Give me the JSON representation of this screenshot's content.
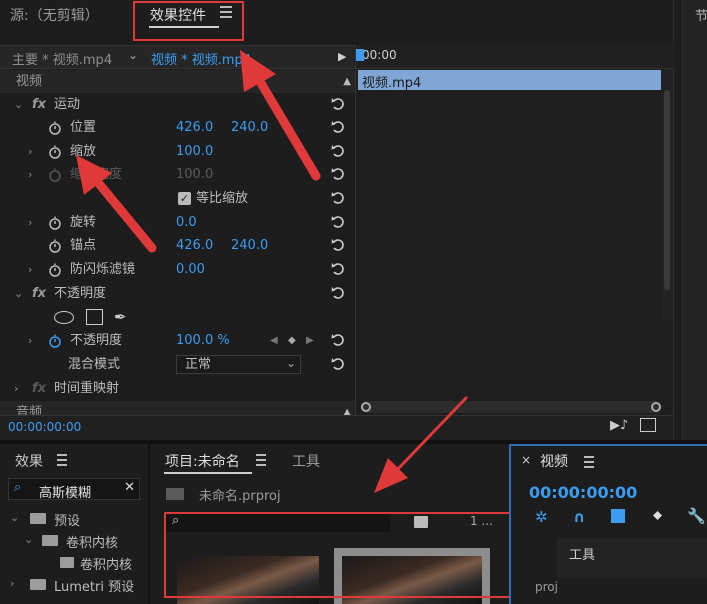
{
  "top": {
    "source_tab": "源:（无剪辑）",
    "effect_controls_tab": "效果控件",
    "right_edge": "节"
  },
  "ec": {
    "master_clip": "主要 * 视频.mp4",
    "seq_clip": "视频 * 视频.mp4",
    "timecode_ruler": "00:00",
    "clip_bar_label": "视频.mp4",
    "section_video": "视频",
    "motion": "运动",
    "position": "位置",
    "position_x": "426.0",
    "position_y": "240.0",
    "scale": "缩放",
    "scale_val": "100.0",
    "scale_width": "缩放宽度",
    "scale_width_val": "100.0",
    "uniform_scale": "等比缩放",
    "rotation": "旋转",
    "rotation_val": "0.0",
    "anchor": "锚点",
    "anchor_x": "426.0",
    "anchor_y": "240.0",
    "antiflicker": "防闪烁滤镜",
    "antiflicker_val": "0.00",
    "opacity_section": "不透明度",
    "opacity": "不透明度",
    "opacity_val": "100.0 %",
    "blend_mode": "混合模式",
    "blend_val": "正常",
    "time_remap": "时间重映射",
    "audio_section": "音频",
    "timecode": "00:00:00:00"
  },
  "effects_panel": {
    "title": "效果",
    "search_value": "高斯模糊",
    "items": [
      "预设",
      "卷积内核",
      "卷积内核",
      "Lumetri 预设"
    ]
  },
  "project_panel": {
    "tab_project": "项目:未命名",
    "tab_tools": "工具",
    "file": "未命名.prproj",
    "count": "1 ..."
  },
  "video_panel": {
    "title": "视频",
    "timecode": "00:00:00:00",
    "tools_popup": "工具",
    "proj_text": "proj"
  },
  "colors": {
    "accent_blue": "#3b9cf0",
    "annotation_red": "#e0393a",
    "clip_bar": "#7fa6d4"
  }
}
